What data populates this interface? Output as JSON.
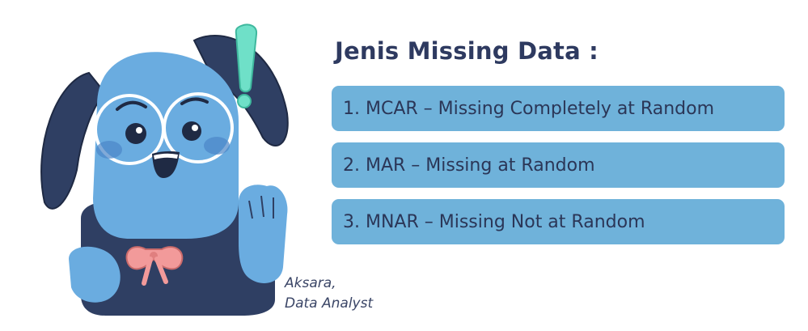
{
  "heading": {
    "title": "Jenis Missing Data :"
  },
  "types": [
    {
      "label": "1. MCAR – Missing Completely at Random"
    },
    {
      "label": "2. MAR – Missing at Random"
    },
    {
      "label": "3. MNAR – Missing Not at Random"
    }
  ],
  "caption": {
    "name": "Aksara,",
    "role": "Data Analyst"
  },
  "colors": {
    "box": "#6fb2da",
    "title": "#2e3a60",
    "mascot_body": "#6aace0",
    "mascot_dark": "#2f3f63",
    "exclamation": "#6fe0c8",
    "bow": "#f29a9a"
  },
  "icons": {
    "mascot": "dog-mascot-illustration",
    "exclamation": "exclamation-icon"
  }
}
